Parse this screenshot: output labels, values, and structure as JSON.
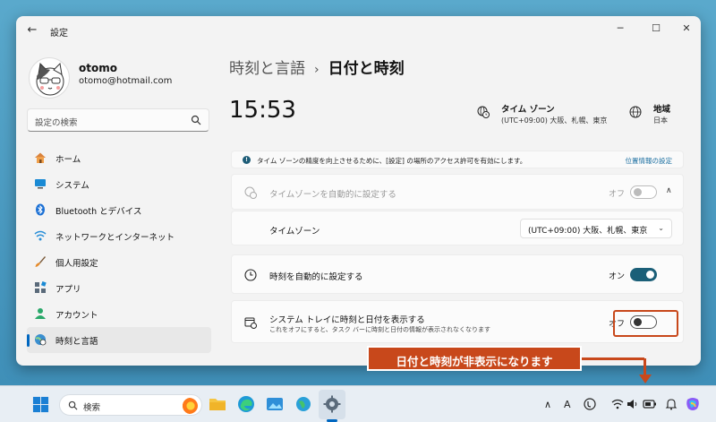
{
  "window": {
    "title": "設定",
    "back": "←",
    "minimize": "─",
    "maximize": "☐",
    "close": "✕"
  },
  "profile": {
    "name": "otomo",
    "email": "otomo@hotmail.com"
  },
  "search": {
    "placeholder": "設定の検索"
  },
  "nav": [
    {
      "label": "ホーム",
      "icon": "home-icon"
    },
    {
      "label": "システム",
      "icon": "monitor-icon"
    },
    {
      "label": "Bluetooth とデバイス",
      "icon": "bluetooth-icon"
    },
    {
      "label": "ネットワークとインターネット",
      "icon": "wifi-icon"
    },
    {
      "label": "個人用設定",
      "icon": "brush-icon"
    },
    {
      "label": "アプリ",
      "icon": "apps-icon"
    },
    {
      "label": "アカウント",
      "icon": "person-icon"
    },
    {
      "label": "時刻と言語",
      "icon": "clock-globe-icon",
      "active": true
    }
  ],
  "breadcrumb": {
    "parent": "時刻と言語",
    "separator": "›",
    "current": "日付と時刻"
  },
  "clock": "15:53",
  "timezone_summary": {
    "title": "タイム ゾーン",
    "value": "(UTC+09:00) 大阪、札幌、東京"
  },
  "region_summary": {
    "title": "地域",
    "value": "日本"
  },
  "info": {
    "icon_glyph": "!",
    "text": "タイム ゾーンの精度を向上させるために、[設定] の場所のアクセス許可を有効にします。",
    "link": "位置情報の設定"
  },
  "settings": {
    "auto_timezone": {
      "label": "タイムゾーンを自動的に設定する",
      "state": "オフ",
      "chevron": "∧"
    },
    "timezone": {
      "label": "タイムゾーン",
      "value": "(UTC+09:00) 大阪、札幌、東京",
      "chevron": "⌄"
    },
    "auto_time": {
      "label": "時刻を自動的に設定する",
      "state": "オン"
    },
    "show_in_tray": {
      "label": "システム トレイに時刻と日付を表示する",
      "sub": "これをオフにすると、タスク バーに時刻と日付の情報が表示されなくなります",
      "state": "オフ"
    }
  },
  "callout": "日付と時刻が非表示になります",
  "taskbar": {
    "search_placeholder": "検索",
    "tray": {
      "chevron": "∧",
      "ime": "A"
    }
  },
  "colors": {
    "accent": "#1b5f78",
    "callout": "#c8481b",
    "active_indicator": "#0067c0"
  }
}
